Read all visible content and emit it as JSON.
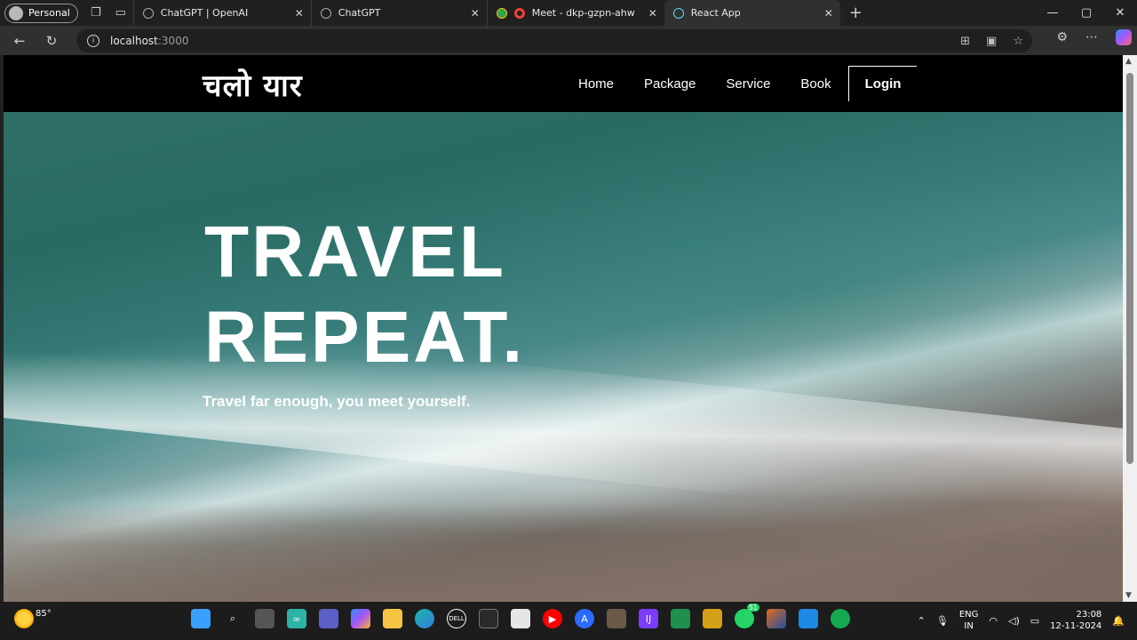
{
  "browser": {
    "profile_label": "Personal",
    "tabs": [
      {
        "title": "ChatGPT | OpenAI",
        "favicon": "openai-icon"
      },
      {
        "title": "ChatGPT",
        "favicon": "openai-icon"
      },
      {
        "title": "Meet - dkp-gzpn-ahw",
        "favicon": "meet-icon"
      },
      {
        "title": "React App",
        "favicon": "react-icon"
      }
    ],
    "url_host": "localhost",
    "url_port": ":3000"
  },
  "site": {
    "logo": "चलो यार",
    "nav": {
      "home": "Home",
      "package": "Package",
      "service": "Service",
      "book": "Book",
      "login": "Login"
    },
    "hero": {
      "line1": "TRAVEL",
      "line2": "REPEAT.",
      "tagline": "Travel far enough, you meet yourself."
    }
  },
  "taskbar": {
    "temperature": "85°",
    "whatsapp_badge": "51",
    "lang_top": "ENG",
    "lang_bottom": "IN",
    "time": "23:08",
    "date": "12-11-2024"
  },
  "colors": {
    "site_nav_bg": "#000000",
    "browser_chrome": "#202020",
    "accent_text": "#ffffff"
  }
}
